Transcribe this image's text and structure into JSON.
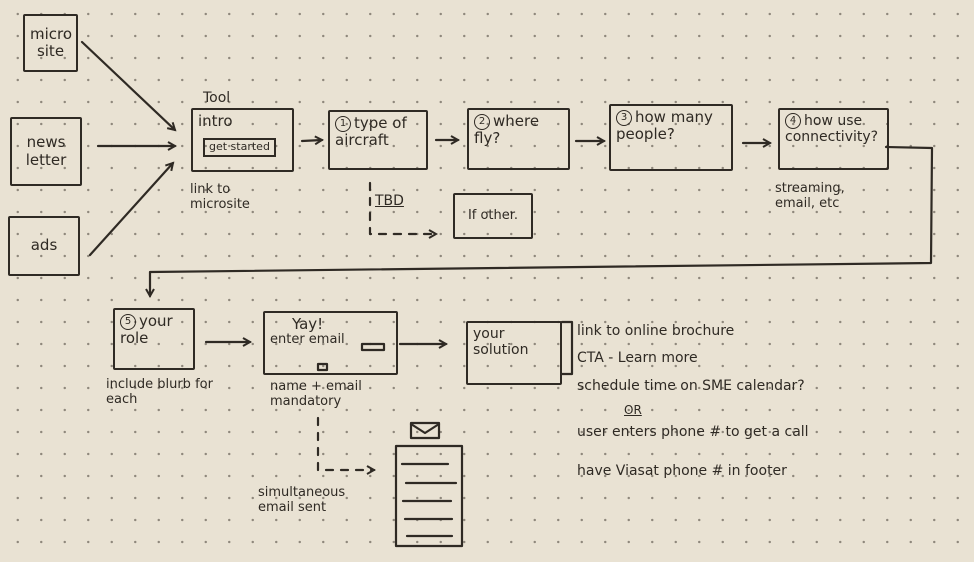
{
  "sources": [
    {
      "id": "microsite",
      "label": "micro site"
    },
    {
      "id": "newsletter",
      "label": "news letter"
    },
    {
      "id": "ads",
      "label": "ads"
    }
  ],
  "tool": {
    "heading": "Tool",
    "title": "intro",
    "button": "get started",
    "note": "link to microsite"
  },
  "steps": [
    {
      "num": "1",
      "label": "type of aircraft"
    },
    {
      "num": "2",
      "label": "where fly?"
    },
    {
      "num": "3",
      "label": "how many people?"
    },
    {
      "num": "4",
      "label": "how use connectivity?",
      "note": "streaming, email, etc"
    },
    {
      "num": "5",
      "label": "your role",
      "note": "include blurb for each"
    }
  ],
  "branch": {
    "tbd_label": "TBD",
    "other_box": "If other."
  },
  "email_step": {
    "title": "Yay!",
    "label": "enter email",
    "note": "name + email mandatory",
    "side_note": "simultaneous email sent"
  },
  "solution": {
    "label": "your solution",
    "notes": [
      "link to online brochure",
      "CTA - Learn more",
      "schedule time on SME calendar?",
      "OR",
      "user enters phone # to get a call",
      "have Viasat phone # in footer"
    ]
  }
}
